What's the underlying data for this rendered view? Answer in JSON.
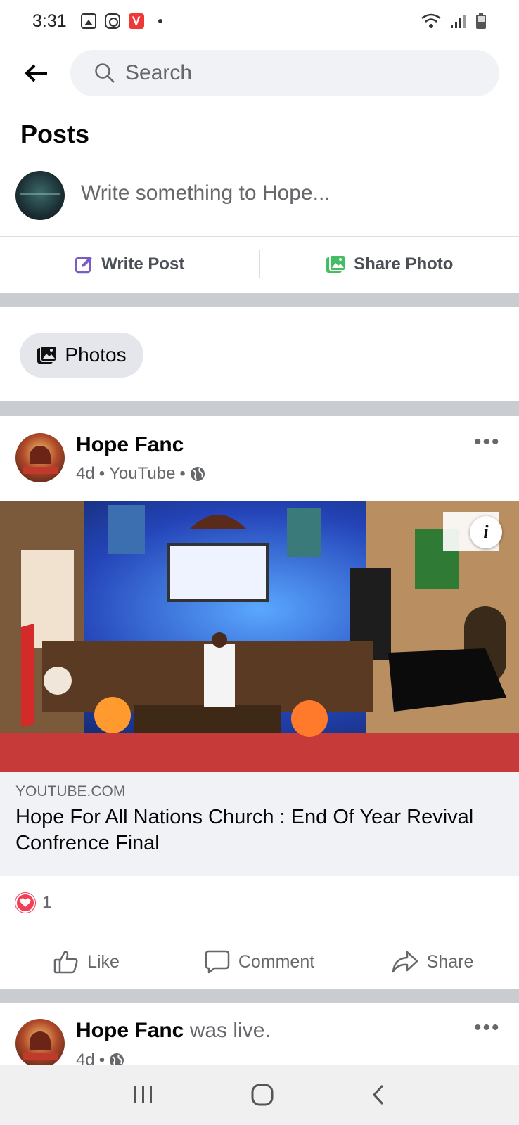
{
  "status_bar": {
    "time": "3:31"
  },
  "search": {
    "placeholder": "Search"
  },
  "posts_section": {
    "title": "Posts",
    "composer_placeholder": "Write something to Hope...",
    "write_post_label": "Write Post",
    "share_photo_label": "Share Photo"
  },
  "photos_chip_label": "Photos",
  "post1": {
    "author": "Hope Fanc",
    "time": "4d",
    "source": "YouTube",
    "link_domain": "YOUTUBE.COM",
    "link_title": "Hope For All Nations Church : End Of Year Revival Confrence Final",
    "reaction_count": "1",
    "like_label": "Like",
    "comment_label": "Comment",
    "share_label": "Share",
    "more": "•••"
  },
  "post2": {
    "author": "Hope Fanc",
    "suffix": " was live.",
    "time": "4d",
    "more": "•••"
  },
  "colors": {
    "accent_blue": "#1877f2",
    "reaction_red": "#f33e58",
    "write_post_purple": "#7b5cc4",
    "share_photo_green": "#45bd62"
  }
}
